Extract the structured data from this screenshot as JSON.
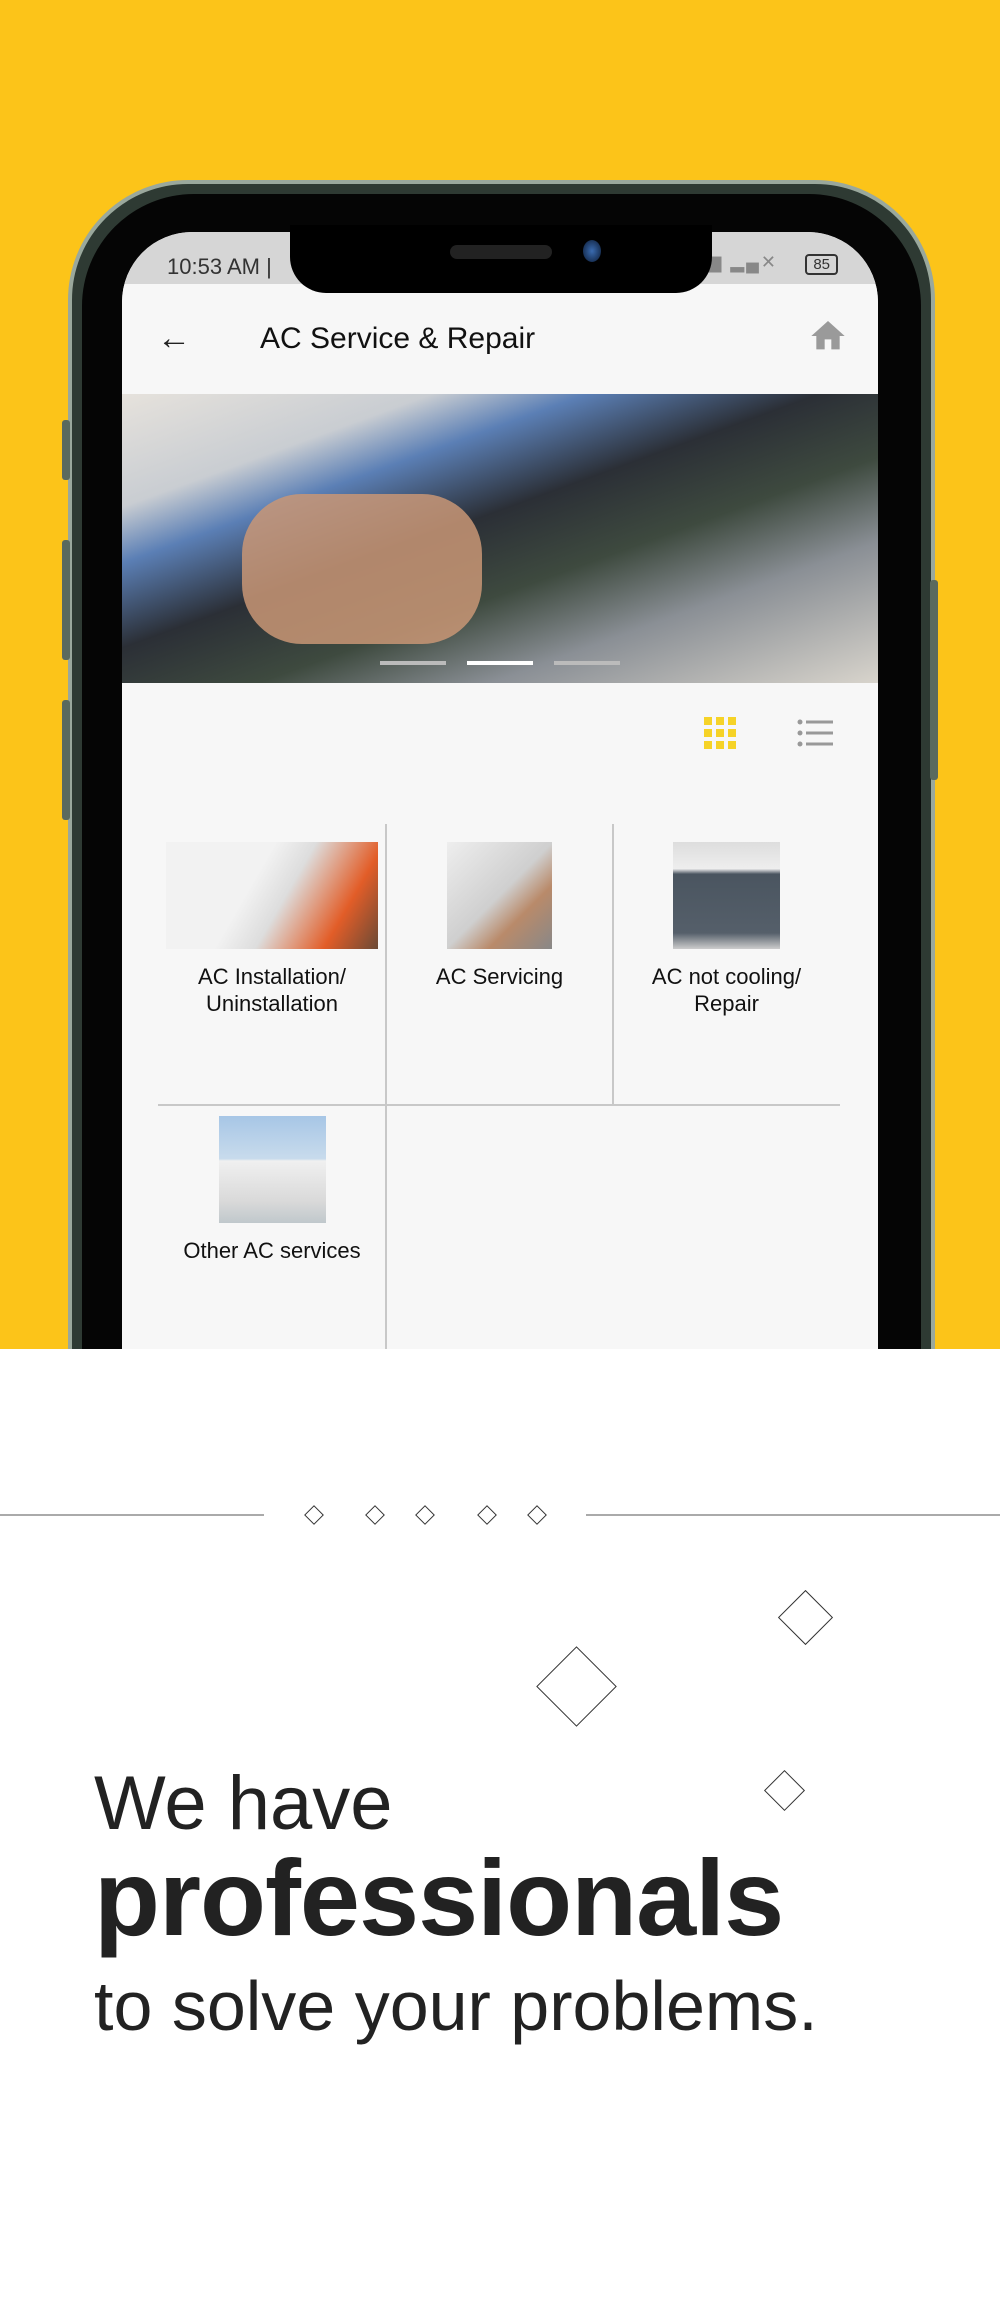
{
  "status_bar": {
    "time": "10:53 AM |",
    "battery": "85",
    "signal": "ᴳ▂▄▆ ▂▄✕"
  },
  "app_bar": {
    "back_icon": "arrow-left",
    "title": "AC Service & Repair",
    "home_icon": "home"
  },
  "banner": {
    "slides": 3,
    "active_slide": 2
  },
  "view_toggle": {
    "grid_icon": "grid",
    "list_icon": "list",
    "active": "grid",
    "accent": "#f6d327"
  },
  "services": [
    {
      "label": "AC Installation/\nUninstallation"
    },
    {
      "label": "AC Servicing"
    },
    {
      "label": "AC not cooling/\nRepair"
    },
    {
      "label": "Other AC services"
    }
  ],
  "tagline": {
    "line1": "We have",
    "line2": "professionals",
    "line3": "to solve your problems."
  },
  "colors": {
    "background": "#fcc419",
    "accent": "#f6d327"
  }
}
